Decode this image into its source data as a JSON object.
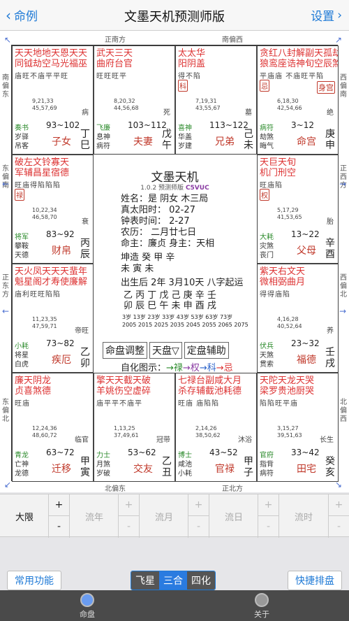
{
  "nav": {
    "back_label": "命例",
    "title": "文墨天机预测师版",
    "settings_label": "设置"
  },
  "directions": {
    "top_left": "正南方",
    "top_right": "南偏西",
    "bottom_left": "北偏东",
    "bottom_right": "正北方",
    "left_1": "南偏东",
    "left_2": "东偏南",
    "left_3": "正东方",
    "left_4": "东偏北",
    "right_1": "西偏南",
    "right_2": "正西方",
    "right_3": "西偏北",
    "right_4": "北偏西"
  },
  "palaces": [
    {
      "stars": "天天地地天恩天天",
      "stars2": "同钺劫空马光福巫",
      "br": "庙旺不庙平平旺",
      "age": "9,21,33\n45,57,69",
      "state": "病",
      "g1": "奏书",
      "g2a": "岁驿",
      "g2b": "吊客",
      "range": "93~102",
      "palace": "子女",
      "stem": "丁巳"
    },
    {
      "stars": "武天三天",
      "stars2": "曲府台官",
      "br": "旺旺旺平",
      "age": "8,20,32\n44,56,68",
      "state": "死",
      "g1": "飞廉",
      "g2a": "息神",
      "g2b": "病符",
      "range": "103~112",
      "palace": "夫妻",
      "stem": "戊午"
    },
    {
      "stars": "太太华",
      "stars2": "阳阴盖",
      "br": "得不陷",
      "tag": "科",
      "age": "7,19,31\n43,55,67",
      "state": "墓",
      "g1": "喜神",
      "g2a": "华盖",
      "g2b": "岁建",
      "range": "113~122",
      "palace": "兄弟",
      "stem": "己未"
    },
    {
      "stars": "贪红八封解副天孤劫",
      "stars2": "狼鸾座诰神旬空辰煞",
      "br": "平庙庙 不庙旺平陷",
      "tag": "忌",
      "tag2": "身宫",
      "age": "6,18,30\n42,54,66",
      "state": "绝",
      "g1": "病符",
      "g2a": "劫煞",
      "g2b": "晦气",
      "range": "3~12",
      "palace": "命宫",
      "stem": "庚申"
    },
    {
      "stars": "破左文铃寡天",
      "stars2": "军辅昌星宿德",
      "br": "旺庙得陷陷陷",
      "tag": "禄",
      "age": "10,22,34\n46,58,70",
      "state": "衰",
      "g1": "将军",
      "g2a": "攀鞍",
      "g2b": "天德",
      "range": "83~92",
      "palace": "财帛",
      "stem": "丙辰"
    },
    {
      "stars": "天巨天旬",
      "stars2": "机门刑空",
      "br": "旺庙陷",
      "tag": "权",
      "age": "5,17,29\n41,53,65",
      "state": "胎",
      "g1": "大耗",
      "g2a": "灾煞",
      "g2b": "丧门",
      "range": "13~22",
      "palace": "父母",
      "stem": "辛酉"
    },
    {
      "stars": "天火凤天天天蜚年",
      "stars2": "魁星阁才寿使廉解",
      "br": "庙利旺旺陷陷",
      "age": "11,23,35\n47,59,71",
      "state": "帝旺",
      "g1": "小耗",
      "g2a": "将星",
      "g2b": "白虎",
      "range": "73~82",
      "palace": "疾厄",
      "stem": "乙卯"
    },
    {
      "stars": "紫天右文天",
      "stars2": "微相弼曲月",
      "br": "得得庙陷",
      "age": "4,16,28\n40,52,64",
      "state": "养",
      "g1": "伏兵",
      "g2a": "天煞",
      "g2b": "贯索",
      "range": "23~32",
      "palace": "福德",
      "stem": "壬戌"
    },
    {
      "stars": "廉天阴龙",
      "stars2": "贞喜煞德",
      "br": "旺庙",
      "age": "12,24,36\n48,60,72",
      "state": "临官",
      "g1": "青龙",
      "g2a": "亡神",
      "g2b": "龙德",
      "range": "63~72",
      "palace": "迁移",
      "stem": "甲寅"
    },
    {
      "stars": "擎天天截天破",
      "stars2": "羊姚伤空虚碎",
      "br": "庙平平不庙平",
      "age": "1,13,25\n37,49,61",
      "state": "冠带",
      "g1": "力士",
      "g2a": "月煞",
      "g2b": "岁破",
      "range": "53~62",
      "palace": "交友",
      "stem": "乙丑"
    },
    {
      "stars": "七禄台副咸大月",
      "stars2": "杀存辅截池耗德",
      "br": "旺庙 庙陷陷",
      "age": "2,14,26\n38,50,62",
      "state": "沐浴",
      "g1": "博士",
      "g2a": "咸池",
      "g2b": "小耗",
      "range": "43~52",
      "palace": "官禄",
      "stem": "甲子"
    },
    {
      "stars": "天陀天龙天哭",
      "stars2": "梁罗贵池厨哭",
      "br": "陷陷旺平庙",
      "age": "3,15,27\n39,51,63",
      "state": "长生",
      "g1": "官府",
      "g2a": "指背",
      "g2b": "病符",
      "range": "33~42",
      "palace": "田宅",
      "stem": "癸亥"
    }
  ],
  "center": {
    "title": "文墨天机",
    "version": "1.0.2 预测师版",
    "code": "C5VUC",
    "line1": "姓名：是          阴女 木三局",
    "line2": "真太阳时：          02-27",
    "line3": "钟表时间：          2-27",
    "line4": "农历：        二月廿七日",
    "line5": "命主：廉贞 身主：天相",
    "line6": "坤造  癸      甲      辛",
    "line7": "        未      寅      未",
    "line8": "出生后 2年 3月10天 八字起运",
    "dayun_stems": "乙  丙  丁  戊  己  庚  辛  壬",
    "dayun_branches": "卯  辰  巳  午  未  申  酉  戌",
    "dayun_ages": "3岁 13岁 23岁 33岁 43岁 53岁 63岁 73岁",
    "dayun_years": "2005 2015 2025 2035 2045 2055 2065 2075",
    "btn1": "命盘调整",
    "btn2": "天盘▽",
    "btn3": "定盘辅助",
    "flow_label": "自化图示：",
    "flow_lu": "→禄",
    "flow_quan": "→权",
    "flow_ke": "→科",
    "flow_ji": "→忌"
  },
  "toolbar": {
    "dayun": "大限",
    "liunian": "流年",
    "liuyue": "流月",
    "liuri": "流日",
    "liushi": "流时",
    "plus": "+",
    "minus": "-"
  },
  "footer": {
    "common": "常用功能",
    "seg1": "飞星",
    "seg2": "三合",
    "seg3": "四化",
    "quick": "快捷排盘"
  },
  "tabs": {
    "chart": "命盘",
    "about": "关于"
  }
}
